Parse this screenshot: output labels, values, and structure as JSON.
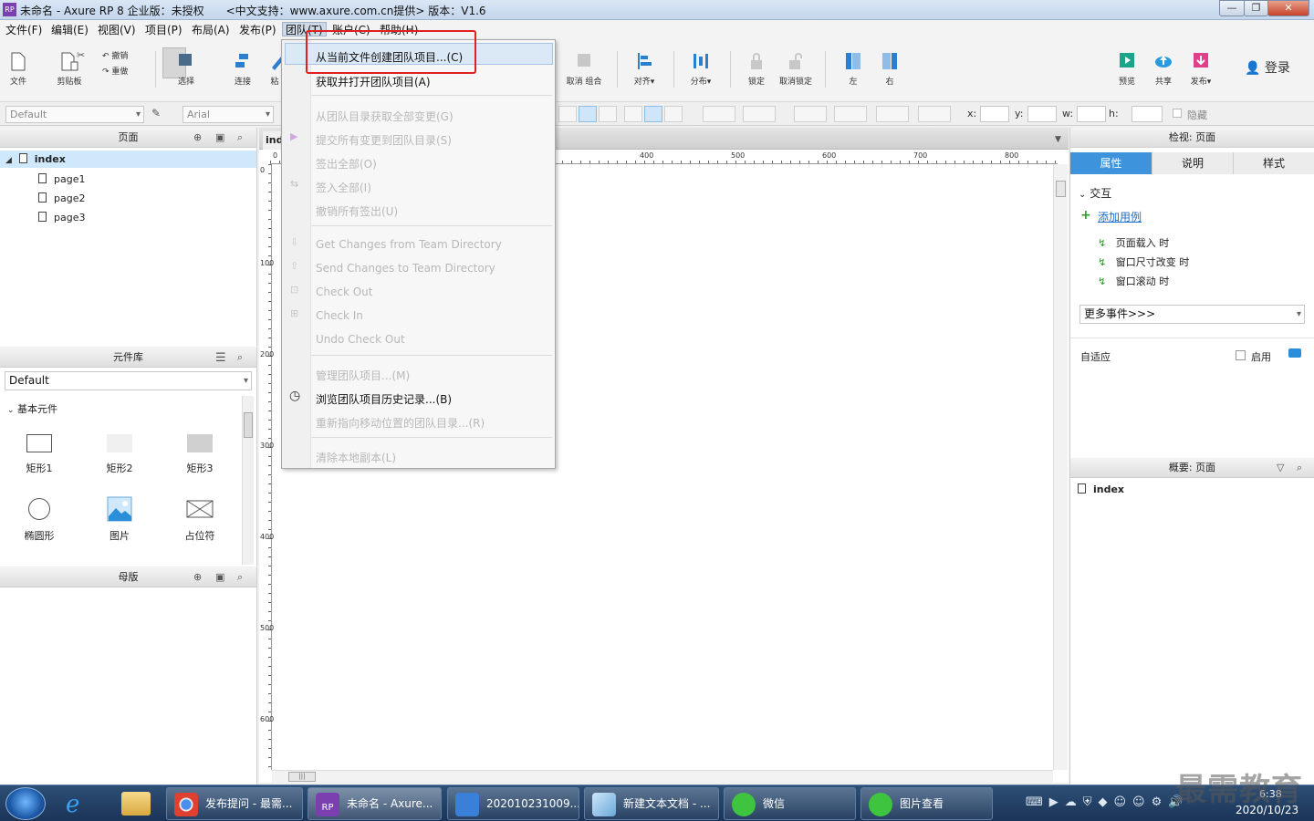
{
  "window": {
    "title": "未命名 - Axure RP 8 企业版：未授权　　<中文支持：www.axure.com.cn提供> 版本：V1.6",
    "logo": "RP",
    "minimize_label": "—",
    "maximize_label": "❐",
    "close_label": "✕"
  },
  "menubar": {
    "items": [
      "文件(F)",
      "编辑(E)",
      "视图(V)",
      "项目(P)",
      "布局(A)",
      "发布(P)",
      "团队(T)",
      "账户(C)",
      "帮助(H)"
    ]
  },
  "toolbar": {
    "file": "文件",
    "clipboard": "剪贴板",
    "undo": "撤销",
    "redo": "重做",
    "select": "选择",
    "connect": "连接",
    "cut_label": "粘",
    "ungroup": "取消 组合",
    "align": "对齐▾",
    "distribute": "分布▾",
    "lock": "锁定",
    "unlock": "取消锁定",
    "left": "左",
    "right": "右",
    "preview": "预览",
    "share": "共享",
    "publish": "发布▾",
    "login": "登录"
  },
  "formatbar": {
    "style_combo": "Default",
    "font_combo": "Arial",
    "x_label": "x:",
    "y_label": "y:",
    "w_label": "w:",
    "h_label": "h:",
    "hide_label": "隐藏"
  },
  "pages_panel": {
    "title": "页面",
    "root": "index",
    "children": [
      "page1",
      "page2",
      "page3"
    ]
  },
  "library_panel": {
    "title": "元件库",
    "selected_library": "Default",
    "group": "基本元件",
    "widgets": [
      "矩形1",
      "矩形2",
      "矩形3",
      "椭圆形",
      "图片",
      "占位符"
    ]
  },
  "masters_panel": {
    "title": "母版"
  },
  "canvas": {
    "tab_label": "ind",
    "ruler_h": [
      "0",
      "400",
      "500",
      "600",
      "700",
      "800"
    ],
    "ruler_v": [
      "0",
      "100",
      "200",
      "300",
      "400",
      "500",
      "600"
    ]
  },
  "team_menu": {
    "items": [
      {
        "label": "从当前文件创建团队项目...(C)",
        "enabled": true
      },
      {
        "label": "获取并打开团队项目(A)",
        "enabled": true
      },
      {
        "label": "从团队目录获取全部变更(G)",
        "enabled": false
      },
      {
        "label": "提交所有变更到团队目录(S)",
        "enabled": false
      },
      {
        "label": "签出全部(O)",
        "enabled": false
      },
      {
        "label": "签入全部(I)",
        "enabled": false
      },
      {
        "label": "撤销所有签出(U)",
        "enabled": false
      },
      {
        "label": "Get Changes from Team Directory",
        "enabled": false
      },
      {
        "label": "Send Changes to Team Directory",
        "enabled": false
      },
      {
        "label": "Check Out",
        "enabled": false
      },
      {
        "label": "Check In",
        "enabled": false
      },
      {
        "label": "Undo Check Out",
        "enabled": false
      },
      {
        "label": "管理团队项目...(M)",
        "enabled": false
      },
      {
        "label": "浏览团队项目历史记录...(B)",
        "enabled": true
      },
      {
        "label": "重新指向移动位置的团队目录...(R)",
        "enabled": false
      },
      {
        "label": "清除本地副本(L)",
        "enabled": false
      }
    ]
  },
  "inspector": {
    "title": "检视: 页面",
    "tabs": [
      "属性",
      "说明",
      "样式"
    ],
    "interaction_label": "交互",
    "add_case": "添加用例",
    "events": [
      "页面载入 时",
      "窗口尺寸改变 时",
      "窗口滚动 时"
    ],
    "more_events": "更多事件>>>",
    "adaptive_label": "自适应",
    "enable_label": "启用"
  },
  "outline_panel": {
    "title": "概要: 页面",
    "root": "index"
  },
  "taskbar": {
    "tasks": [
      "发布提问 - 最需...",
      "未命名 - Axure...",
      "20201023100​9...",
      "新建文本文档 - ...",
      "微信",
      "图片查看"
    ],
    "time": "6:38",
    "date": "2020/10/23",
    "watermark": "最需教育"
  },
  "colors": {
    "accent": "#3d94dc",
    "highlight_box": "#e02020",
    "link": "#1a6fc9"
  }
}
